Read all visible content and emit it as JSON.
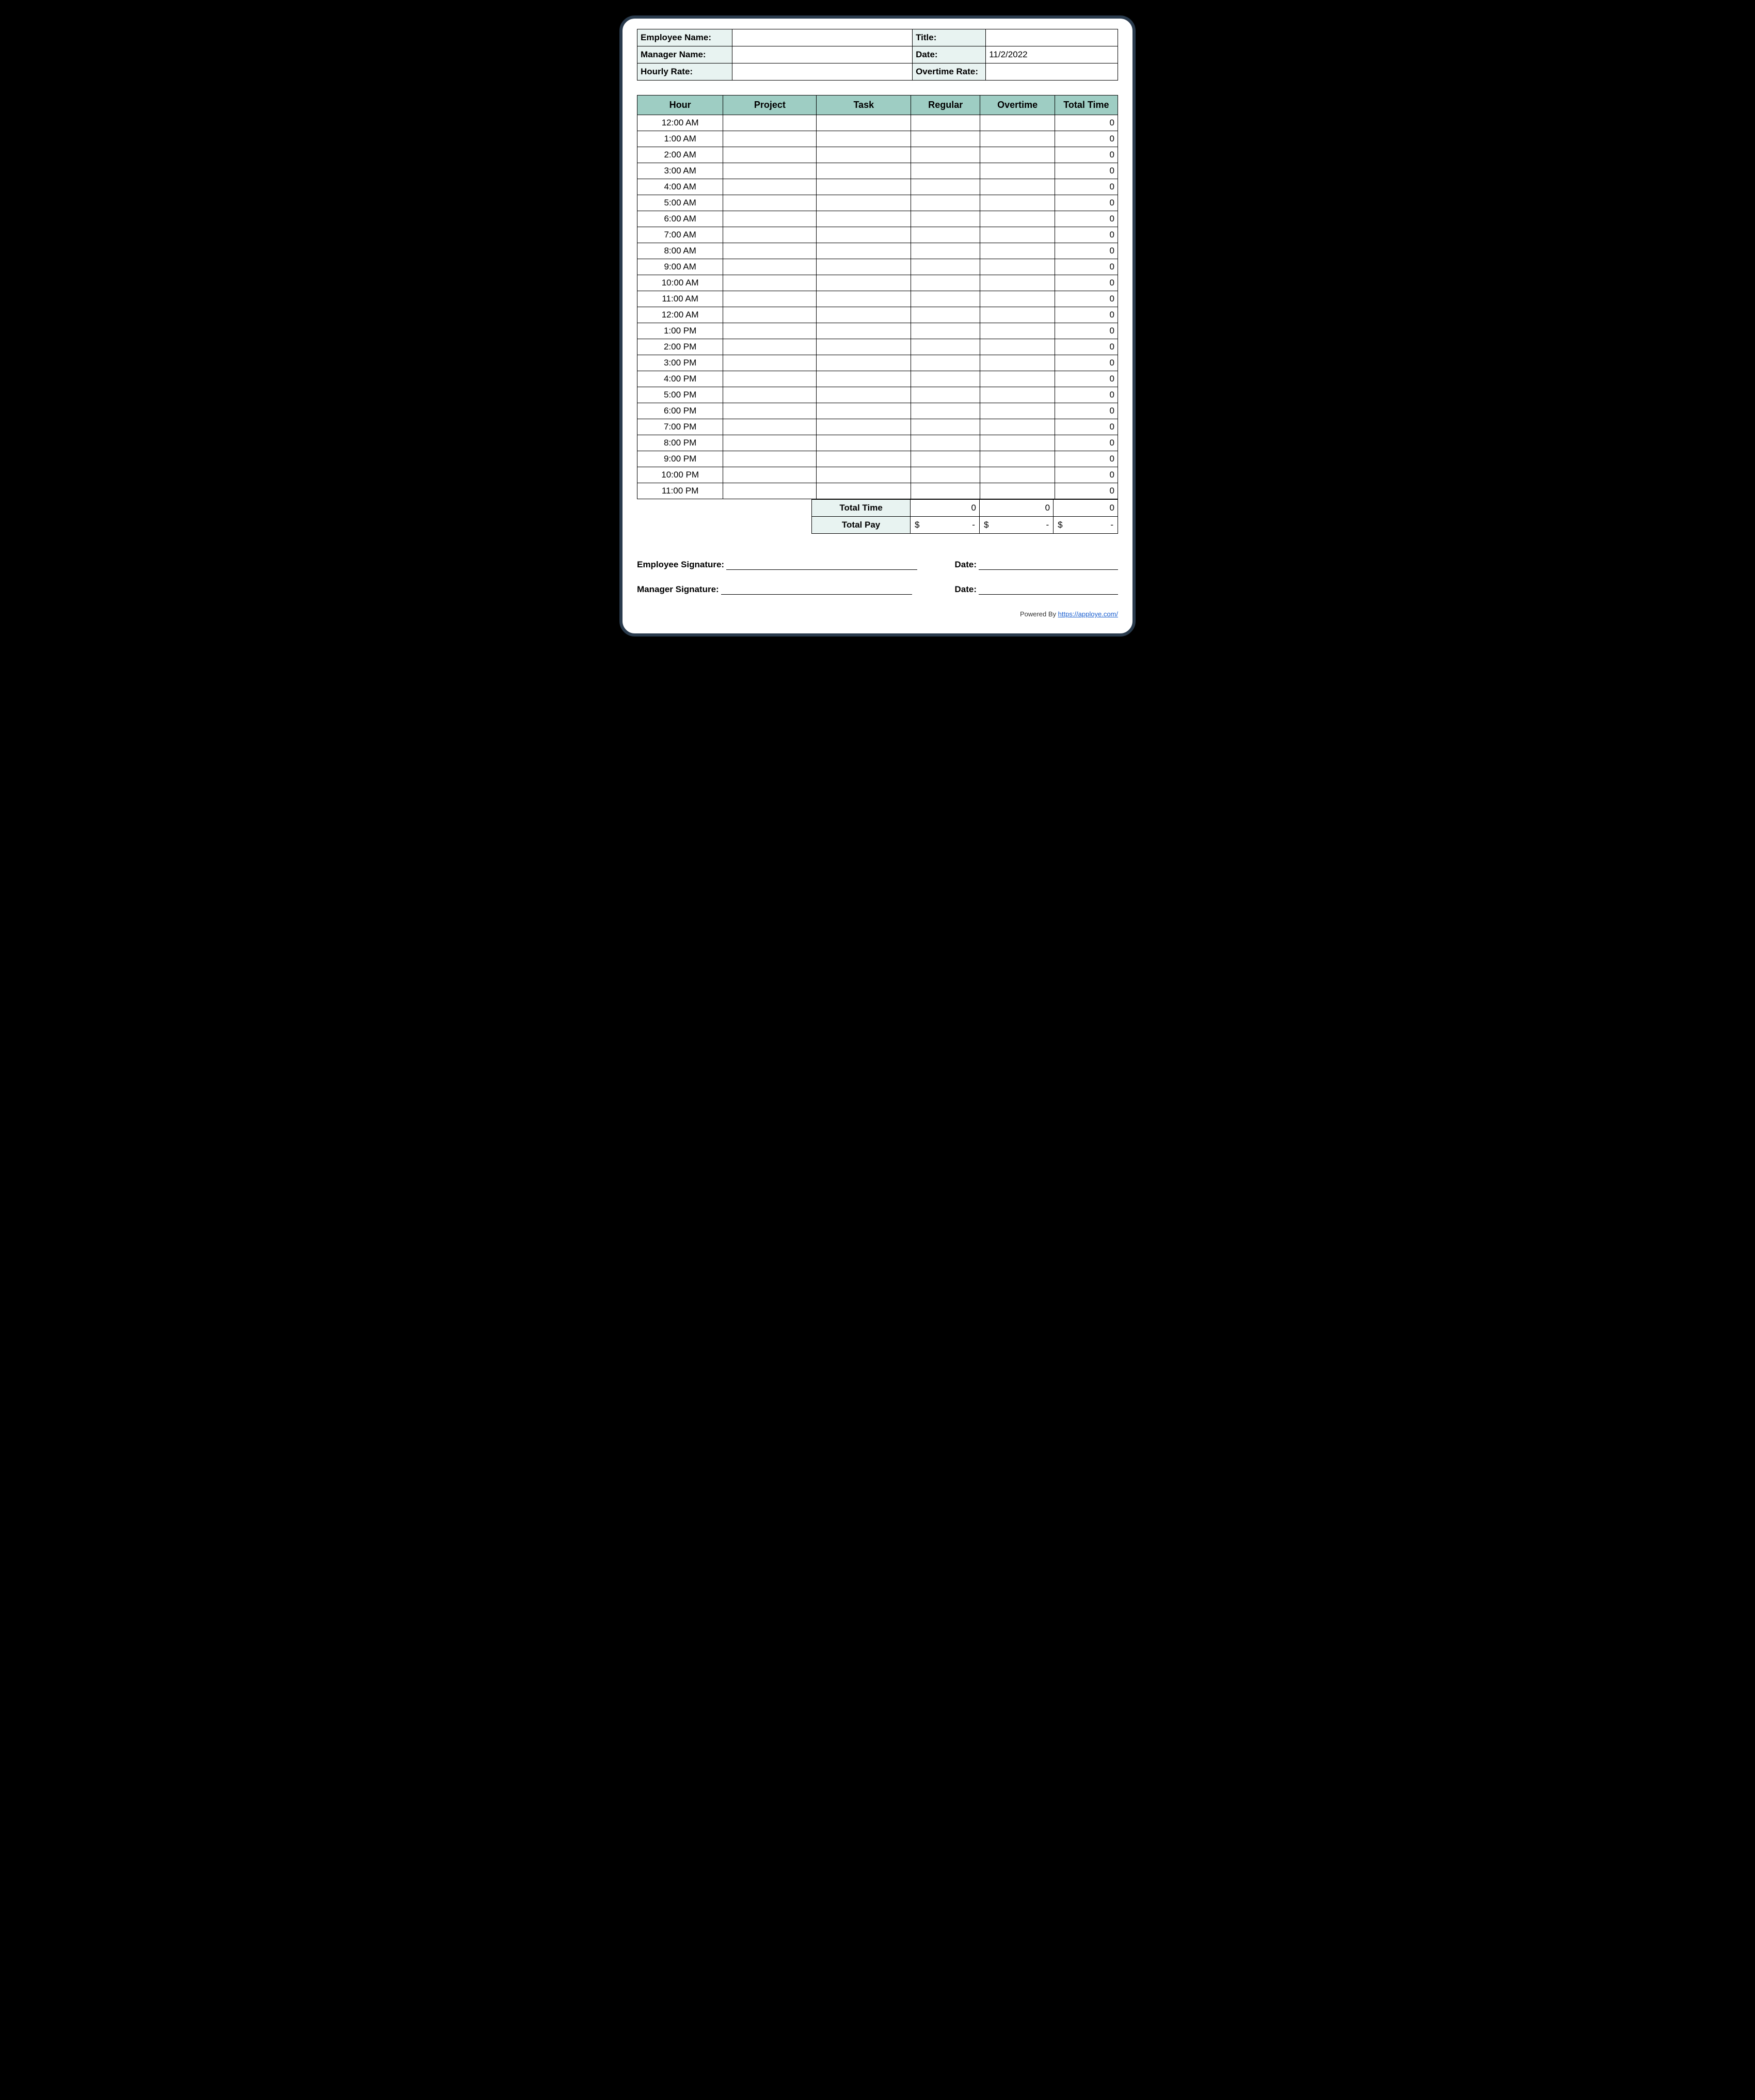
{
  "info": {
    "employee_name_label": "Employee Name:",
    "employee_name_value": "",
    "title_label": "Title:",
    "title_value": "",
    "manager_name_label": "Manager Name:",
    "manager_name_value": "",
    "date_label": "Date:",
    "date_value": "11/2/2022",
    "hourly_rate_label": "Hourly Rate:",
    "hourly_rate_value": "",
    "overtime_rate_label": "Overtime Rate:",
    "overtime_rate_value": ""
  },
  "columns": {
    "hour": "Hour",
    "project": "Project",
    "task": "Task",
    "regular": "Regular",
    "overtime": "Overtime",
    "total": "Total Time"
  },
  "rows": [
    {
      "hour": "12:00 AM",
      "project": "",
      "task": "",
      "regular": "",
      "overtime": "",
      "total": "0"
    },
    {
      "hour": "1:00 AM",
      "project": "",
      "task": "",
      "regular": "",
      "overtime": "",
      "total": "0"
    },
    {
      "hour": "2:00 AM",
      "project": "",
      "task": "",
      "regular": "",
      "overtime": "",
      "total": "0"
    },
    {
      "hour": "3:00 AM",
      "project": "",
      "task": "",
      "regular": "",
      "overtime": "",
      "total": "0"
    },
    {
      "hour": "4:00 AM",
      "project": "",
      "task": "",
      "regular": "",
      "overtime": "",
      "total": "0"
    },
    {
      "hour": "5:00 AM",
      "project": "",
      "task": "",
      "regular": "",
      "overtime": "",
      "total": "0"
    },
    {
      "hour": "6:00 AM",
      "project": "",
      "task": "",
      "regular": "",
      "overtime": "",
      "total": "0"
    },
    {
      "hour": "7:00 AM",
      "project": "",
      "task": "",
      "regular": "",
      "overtime": "",
      "total": "0"
    },
    {
      "hour": "8:00 AM",
      "project": "",
      "task": "",
      "regular": "",
      "overtime": "",
      "total": "0"
    },
    {
      "hour": "9:00 AM",
      "project": "",
      "task": "",
      "regular": "",
      "overtime": "",
      "total": "0"
    },
    {
      "hour": "10:00 AM",
      "project": "",
      "task": "",
      "regular": "",
      "overtime": "",
      "total": "0"
    },
    {
      "hour": "11:00 AM",
      "project": "",
      "task": "",
      "regular": "",
      "overtime": "",
      "total": "0"
    },
    {
      "hour": "12:00 AM",
      "project": "",
      "task": "",
      "regular": "",
      "overtime": "",
      "total": "0"
    },
    {
      "hour": "1:00 PM",
      "project": "",
      "task": "",
      "regular": "",
      "overtime": "",
      "total": "0"
    },
    {
      "hour": "2:00 PM",
      "project": "",
      "task": "",
      "regular": "",
      "overtime": "",
      "total": "0"
    },
    {
      "hour": "3:00 PM",
      "project": "",
      "task": "",
      "regular": "",
      "overtime": "",
      "total": "0"
    },
    {
      "hour": "4:00 PM",
      "project": "",
      "task": "",
      "regular": "",
      "overtime": "",
      "total": "0"
    },
    {
      "hour": "5:00 PM",
      "project": "",
      "task": "",
      "regular": "",
      "overtime": "",
      "total": "0"
    },
    {
      "hour": "6:00 PM",
      "project": "",
      "task": "",
      "regular": "",
      "overtime": "",
      "total": "0"
    },
    {
      "hour": "7:00 PM",
      "project": "",
      "task": "",
      "regular": "",
      "overtime": "",
      "total": "0"
    },
    {
      "hour": "8:00 PM",
      "project": "",
      "task": "",
      "regular": "",
      "overtime": "",
      "total": "0"
    },
    {
      "hour": "9:00 PM",
      "project": "",
      "task": "",
      "regular": "",
      "overtime": "",
      "total": "0"
    },
    {
      "hour": "10:00 PM",
      "project": "",
      "task": "",
      "regular": "",
      "overtime": "",
      "total": "0"
    },
    {
      "hour": "11:00 PM",
      "project": "",
      "task": "",
      "regular": "",
      "overtime": "",
      "total": "0"
    }
  ],
  "totals": {
    "total_time_label": "Total Time",
    "regular_total": "0",
    "overtime_total": "0",
    "grand_total": "0",
    "total_pay_label": "Total Pay",
    "currency": "$",
    "dash": "-"
  },
  "signatures": {
    "employee_label": "Employee Signature:",
    "manager_label": "Manager Signature:",
    "date_label": "Date:"
  },
  "footer": {
    "powered_by": "Powered By ",
    "link_text": "https://apploye.com/"
  }
}
